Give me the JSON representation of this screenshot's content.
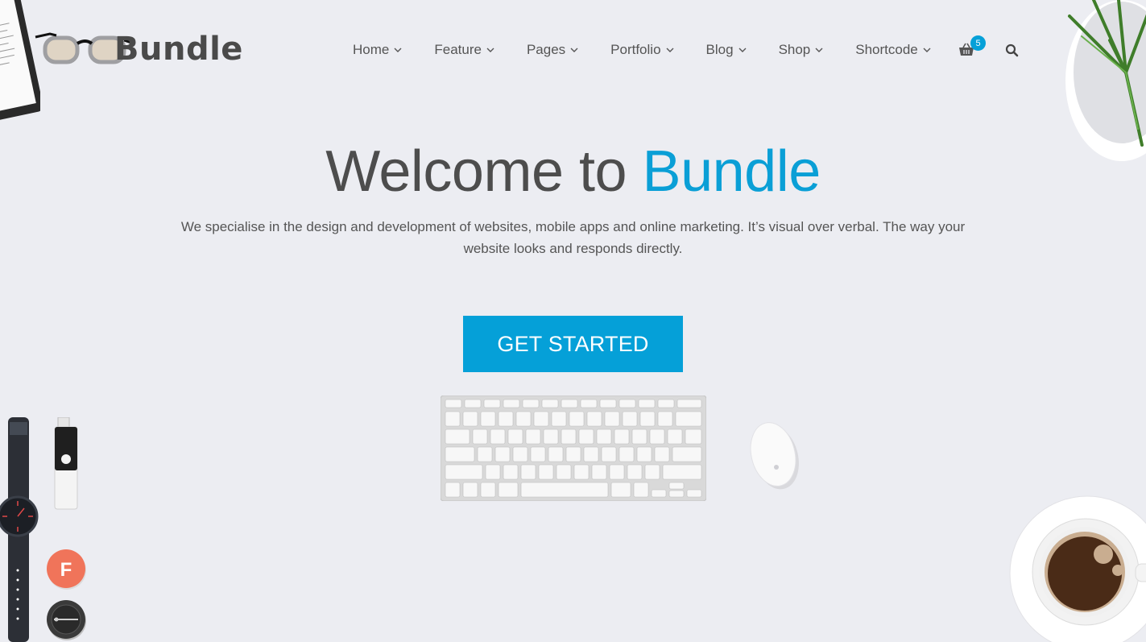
{
  "brand": {
    "name": "Bundle"
  },
  "nav": {
    "items": [
      {
        "label": "Home"
      },
      {
        "label": "Feature"
      },
      {
        "label": "Pages"
      },
      {
        "label": "Portfolio"
      },
      {
        "label": "Blog"
      },
      {
        "label": "Shop"
      },
      {
        "label": "Shortcode"
      }
    ],
    "cart_count": "5"
  },
  "hero": {
    "title_prefix": "Welcome to ",
    "title_accent": "Bundle",
    "description": "We specialise in the design and development of websites, mobile apps and online marketing. It’s visual over verbal. The way your website looks and responds directly.",
    "cta_label": "GET STARTED"
  },
  "decor": {
    "badge_letter": "F"
  },
  "icons": {
    "nav_dropdown": "chevron-down-icon",
    "cart": "shopping-basket-icon",
    "search": "search-icon"
  },
  "colors": {
    "background": "#ecedf2",
    "accent": "#05a0d8",
    "text": "#555555",
    "badge_orange": "#f0745a"
  }
}
